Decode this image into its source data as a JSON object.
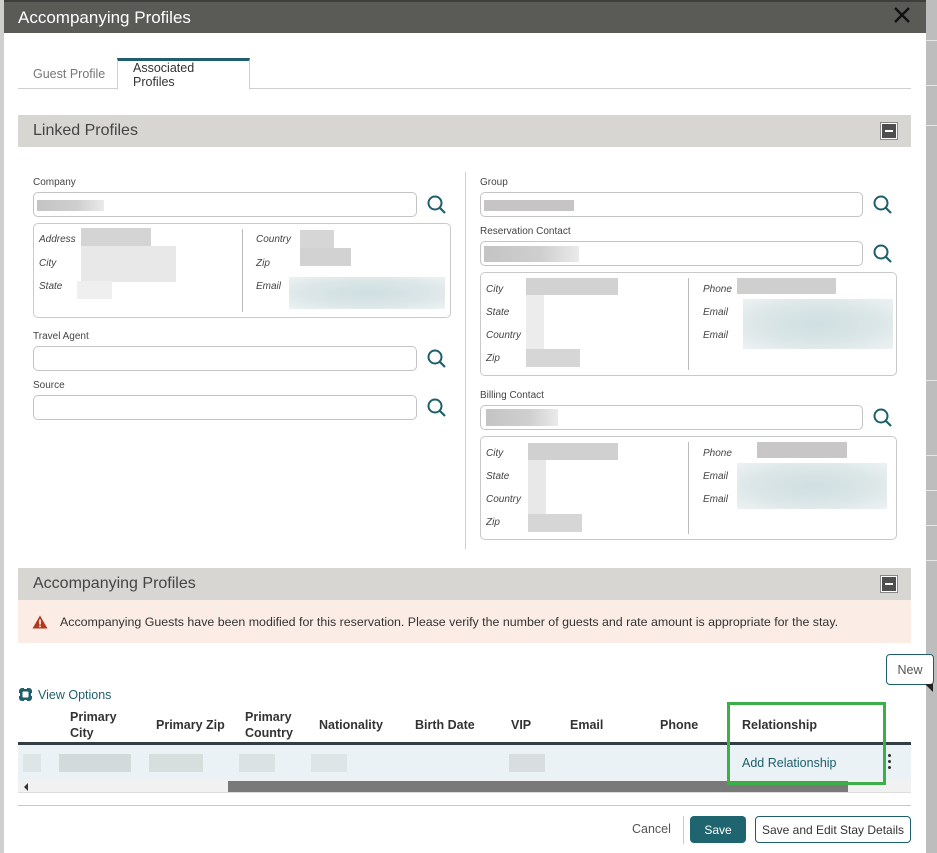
{
  "dialog": {
    "title": "Accompanying Profiles",
    "close_icon": "close-icon"
  },
  "tabs": [
    {
      "label": "Guest Profile",
      "active": false
    },
    {
      "label": "Associated Profiles",
      "active": true
    }
  ],
  "linked_profiles": {
    "title": "Linked Profiles",
    "collapse_icon": "minus-icon",
    "company": {
      "label": "Company",
      "value": "[redacted]",
      "details": {
        "left": [
          "Address",
          "City",
          "State"
        ],
        "right": [
          "Country",
          "Zip",
          "Email"
        ]
      }
    },
    "travel_agent": {
      "label": "Travel Agent",
      "value": ""
    },
    "source": {
      "label": "Source",
      "value": ""
    },
    "group": {
      "label": "Group",
      "value": "[redacted]"
    },
    "reservation_contact": {
      "label": "Reservation Contact",
      "value": "[redacted]",
      "details": {
        "left": [
          "City",
          "State",
          "Country",
          "Zip"
        ],
        "right": [
          "Phone",
          "Email",
          "Email"
        ]
      }
    },
    "billing_contact": {
      "label": "Billing Contact",
      "value": "[redacted]",
      "details": {
        "left": [
          "City",
          "State",
          "Country",
          "Zip"
        ],
        "right": [
          "Phone",
          "Email",
          "Email"
        ]
      }
    }
  },
  "accompanying_profiles": {
    "title": "Accompanying Profiles",
    "collapse_icon": "minus-icon",
    "warning": {
      "icon": "warning-triangle-icon",
      "message": "Accompanying Guests have been modified for this reservation. Please verify the number of guests and rate amount is appropriate for the stay."
    },
    "new_button": "New",
    "view_options": "View Options",
    "table": {
      "columns": [
        "Primary City",
        "Primary Zip",
        "Primary Country",
        "Nationality",
        "Birth Date",
        "VIP",
        "Email",
        "Phone",
        "Relationship"
      ],
      "column_lines": [
        [
          "Primary",
          "City"
        ],
        [
          "Primary Zip"
        ],
        [
          "Primary",
          "Country"
        ],
        [
          "Nationality"
        ],
        [
          "Birth Date"
        ],
        [
          "VIP"
        ],
        [
          "Email"
        ],
        [
          "Phone"
        ],
        [
          "Relationship"
        ]
      ],
      "rows": [
        {
          "primary_city": "[redacted]",
          "primary_zip": "[redacted]",
          "primary_country": "[redacted]",
          "nationality": "[redacted]",
          "birth_date": "",
          "vip": "[redacted]",
          "email": "",
          "phone": "",
          "relationship": "Add Relationship"
        }
      ]
    }
  },
  "footer": {
    "cancel": "Cancel",
    "save": "Save",
    "save_and_edit": "Save and Edit Stay Details"
  },
  "colors": {
    "accent": "#1e5f6b",
    "titlebar": "#5a5a57",
    "section_header": "#d7d6d2",
    "warning_bg": "#fbece6",
    "warning_icon": "#b5381d",
    "highlight": "#3cae4a"
  }
}
